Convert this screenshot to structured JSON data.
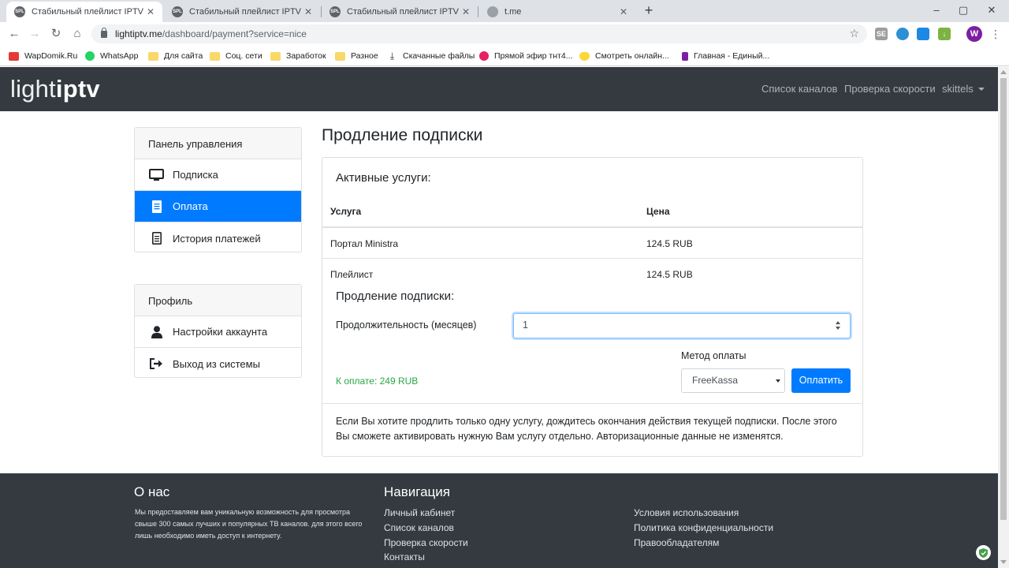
{
  "browser": {
    "tabs": [
      {
        "title": "Стабильный плейлист IPTV",
        "favicon": "SPL"
      },
      {
        "title": "Стабильный плейлист IPTV",
        "favicon": "SPL"
      },
      {
        "title": "Стабильный плейлист IPTV",
        "favicon": "SPL"
      },
      {
        "title": "t.me",
        "favicon": ""
      }
    ],
    "url_host": "lightiptv.me",
    "url_path": "/dashboard/payment?service=nice",
    "profile_initial": "W",
    "bookmarks": [
      {
        "label": "WapDomik.Ru"
      },
      {
        "label": "WhatsApp"
      },
      {
        "label": "Для сайта"
      },
      {
        "label": "Соц. сети"
      },
      {
        "label": "Заработок"
      },
      {
        "label": "Разное"
      },
      {
        "label": "Скачанные файлы"
      },
      {
        "label": "Прямой эфир тнт4..."
      },
      {
        "label": "Смотреть онлайн..."
      },
      {
        "label": "Главная - Единый..."
      }
    ]
  },
  "navbar": {
    "brand_light": "light",
    "brand_bold": "iptv",
    "links": [
      {
        "label": "Список каналов"
      },
      {
        "label": "Проверка скорости"
      }
    ],
    "user": "skittels"
  },
  "sidebar": {
    "panel_title": "Панель управления",
    "panel_items": [
      {
        "label": "Подписка",
        "icon": "monitor-icon"
      },
      {
        "label": "Оплата",
        "icon": "document-icon",
        "active": true
      },
      {
        "label": "История платежей",
        "icon": "list-icon"
      }
    ],
    "profile_title": "Профиль",
    "profile_items": [
      {
        "label": "Настройки аккаунта",
        "icon": "user-icon"
      },
      {
        "label": "Выход из системы",
        "icon": "logout-icon"
      }
    ]
  },
  "main": {
    "title": "Продление подписки",
    "active_services_title": "Активные услуги:",
    "table": {
      "headers": [
        "Услуга",
        "Цена"
      ],
      "rows": [
        [
          "Портал Ministra",
          "124.5 RUB"
        ],
        [
          "Плейлист",
          "124.5 RUB"
        ]
      ]
    },
    "renewal_title": "Продление подписки:",
    "duration_label": "Продолжительность (месяцев)",
    "duration_value": "1",
    "method_label": "Метод оплаты",
    "method_value": "FreeKassa",
    "pay_button": "Оплатить",
    "total": "К оплате: 249 RUB",
    "note": "Если Вы хотите продлить только одну услугу, дождитесь окончания действия текущей подписки. После этого Вы сможете активировать нужную Вам услугу отдельно. Авторизационные данные не изменятся."
  },
  "footer": {
    "about_title": "О нас",
    "about_text": "Мы предоставляем вам уникальную возможность для просмотра свыше 300 самых лучших и популярных ТВ каналов. для этого всего лишь необходимо иметь доступ к интернету.",
    "nav_title": "Навигация",
    "nav_links": [
      "Личный кабинет",
      "Список каналов",
      "Проверка скорости",
      "Контакты"
    ],
    "legal_links": [
      "Условия использования",
      "Политика конфиденциальности",
      "Правообладателям"
    ]
  },
  "colors": {
    "primary": "#007bff",
    "navbar": "#343a40",
    "success": "#28a745"
  }
}
